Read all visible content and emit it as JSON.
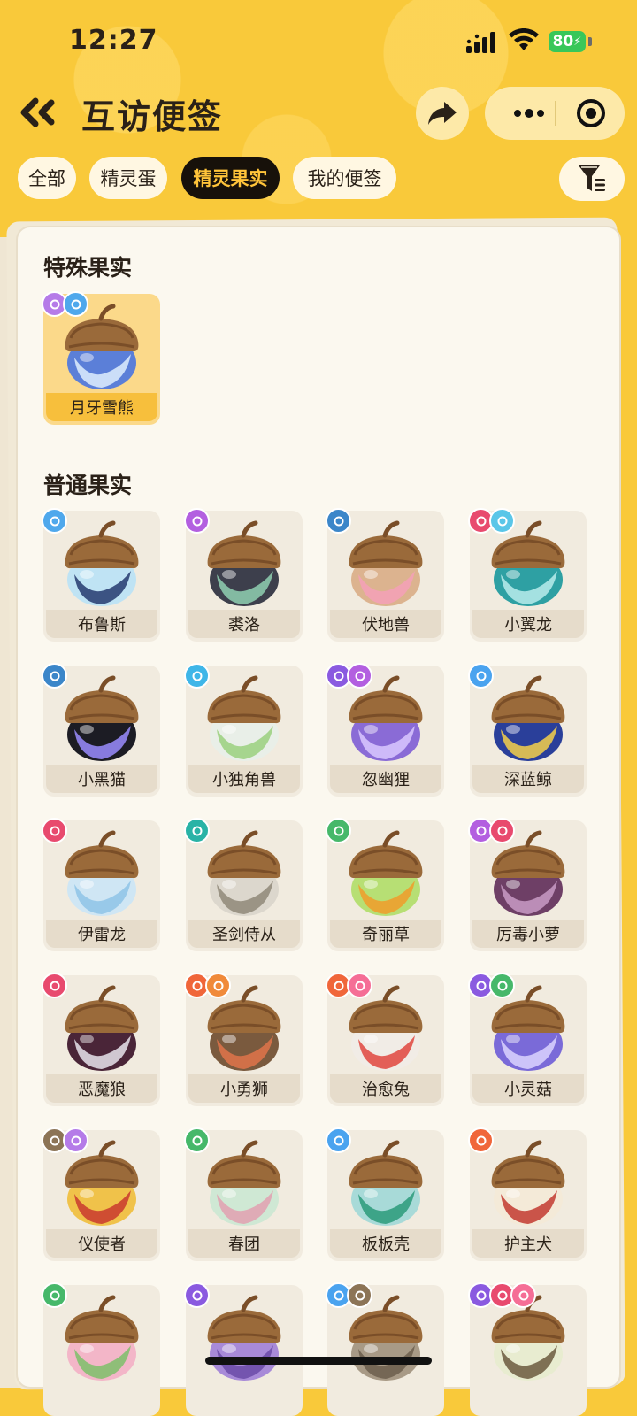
{
  "status": {
    "time": "12:27",
    "battery": "80"
  },
  "header": {
    "title": "互访便签"
  },
  "tabs": [
    {
      "label": "全部",
      "active": false
    },
    {
      "label": "精灵蛋",
      "active": false
    },
    {
      "label": "精灵果实",
      "active": true
    },
    {
      "label": "我的便签",
      "active": false
    }
  ],
  "special_section": {
    "title": "特殊果实",
    "items": [
      {
        "name": "月牙雪熊",
        "badges": [
          "wind",
          "ice"
        ],
        "body": "#5b7fd8",
        "accent": "#dfeefe"
      }
    ]
  },
  "normal_section": {
    "title": "普通果实",
    "items": [
      {
        "name": "布鲁斯",
        "badges": [
          "ice"
        ],
        "body": "#bfe3f4",
        "accent": "#243a6e"
      },
      {
        "name": "裘洛",
        "badges": [
          "phantom"
        ],
        "body": "#3d3f4c",
        "accent": "#8fd0b2"
      },
      {
        "name": "伏地兽",
        "badges": [
          "normal"
        ],
        "body": "#dcb38f",
        "accent": "#f4a0b8"
      },
      {
        "name": "小翼龙",
        "badges": [
          "demon",
          "wing"
        ],
        "body": "#2ea0a3",
        "accent": "#b9ecec"
      },
      {
        "name": "小黑猫",
        "badges": [
          "normal"
        ],
        "body": "#1c1c24",
        "accent": "#9a8cff"
      },
      {
        "name": "小独角兽",
        "badges": [
          "light"
        ],
        "body": "#e9efe8",
        "accent": "#9ad07e"
      },
      {
        "name": "忽幽狸",
        "badges": [
          "ghost",
          "phantom"
        ],
        "body": "#8a6bd6",
        "accent": "#d9c8ff"
      },
      {
        "name": "深蓝鲸",
        "badges": [
          "water"
        ],
        "body": "#2a3f9a",
        "accent": "#f4d04a"
      },
      {
        "name": "伊雷龙",
        "badges": [
          "demon"
        ],
        "body": "#cfe6f4",
        "accent": "#8ec3e6"
      },
      {
        "name": "圣剑侍从",
        "badges": [
          "mech"
        ],
        "body": "#dcd7cd",
        "accent": "#8f8878"
      },
      {
        "name": "奇丽草",
        "badges": [
          "grass"
        ],
        "body": "#b7df74",
        "accent": "#f19c2a"
      },
      {
        "name": "厉毒小萝",
        "badges": [
          "phantom",
          "demon"
        ],
        "body": "#6e3f66",
        "accent": "#c99bc6"
      },
      {
        "name": "恶魔狼",
        "badges": [
          "demon"
        ],
        "body": "#4a2538",
        "accent": "#e8e4ec"
      },
      {
        "name": "小勇狮",
        "badges": [
          "fire",
          "power"
        ],
        "body": "#7a5a3e",
        "accent": "#e0744a"
      },
      {
        "name": "治愈兔",
        "badges": [
          "fire",
          "heal"
        ],
        "body": "#f1ece6",
        "accent": "#e0463e"
      },
      {
        "name": "小灵菇",
        "badges": [
          "ghost",
          "grass"
        ],
        "body": "#7a6ad8",
        "accent": "#dcd4ff"
      },
      {
        "name": "仪使者",
        "badges": [
          "earth",
          "wind"
        ],
        "body": "#f0c24a",
        "accent": "#c9382e"
      },
      {
        "name": "春团",
        "badges": [
          "grass"
        ],
        "body": "#cfe8d4",
        "accent": "#e2a0b0"
      },
      {
        "name": "板板壳",
        "badges": [
          "water"
        ],
        "body": "#a8dad8",
        "accent": "#2a9a7a"
      },
      {
        "name": "护主犬",
        "badges": [
          "fire"
        ],
        "body": "#f4ead8",
        "accent": "#c23a30"
      },
      {
        "name": "",
        "badges": [
          "grass"
        ],
        "body": "#f3b6c8",
        "accent": "#7cc06a"
      },
      {
        "name": "",
        "badges": [
          "ghost"
        ],
        "body": "#a88ad8",
        "accent": "#6b4aa8"
      },
      {
        "name": "",
        "badges": [
          "water",
          "earth"
        ],
        "body": "#a89a86",
        "accent": "#6c5e4c"
      },
      {
        "name": "",
        "badges": [
          "ghost",
          "demon",
          "heal"
        ],
        "body": "#e8ecd0",
        "accent": "#6b5a3e"
      }
    ]
  },
  "badge_colors": {
    "wind": "#b57be8",
    "ice": "#4fa8ec",
    "phantom": "#b35fe0",
    "normal": "#3b86c9",
    "demon": "#e84a6e",
    "wing": "#5ac6e8",
    "light": "#3fb6e8",
    "ghost": "#8a5ae0",
    "water": "#4aa3ef",
    "mech": "#29b3a6",
    "grass": "#46b86a",
    "fire": "#f0663a",
    "power": "#f08a3a",
    "heal": "#f56e96",
    "earth": "#8c7456"
  },
  "icons": {
    "back": "double-chevron-left-icon",
    "share": "share-arrow-icon",
    "more": "more-dots-icon",
    "close": "target-close-icon",
    "filter": "filter-funnel-icon"
  }
}
